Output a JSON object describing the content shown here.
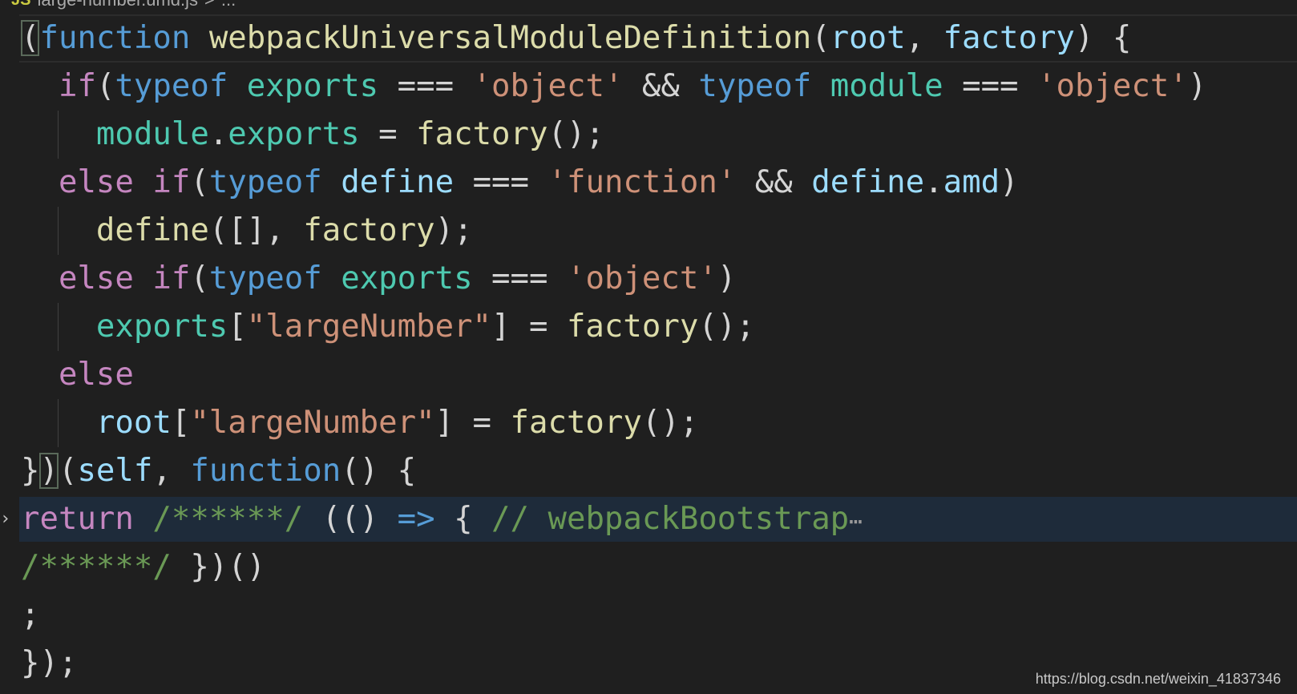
{
  "breadcrumb": {
    "icon": "JS",
    "file": "large-number.umd.js",
    "sep": ">",
    "more": "..."
  },
  "colors": {
    "keyword": "#c586c0",
    "storage": "#569cd6",
    "func": "#dcdcaa",
    "var": "#9cdcfe",
    "module": "#4ec9b0",
    "string": "#ce9178",
    "comment": "#6a9955",
    "punct": "#d4d4d4"
  },
  "lines": [
    {
      "tokens": [
        {
          "t": "(",
          "c": "punct",
          "box": true
        },
        {
          "t": "function",
          "c": "storage"
        },
        {
          "t": " "
        },
        {
          "t": "webpackUniversalModuleDefinition",
          "c": "func"
        },
        {
          "t": "("
        },
        {
          "t": "root",
          "c": "var"
        },
        {
          "t": ", "
        },
        {
          "t": "factory",
          "c": "var"
        },
        {
          "t": ") {"
        }
      ],
      "cursor": true
    },
    {
      "indent": "  ",
      "tokens": [
        {
          "t": "if",
          "c": "keyword"
        },
        {
          "t": "("
        },
        {
          "t": "typeof",
          "c": "storage"
        },
        {
          "t": " "
        },
        {
          "t": "exports",
          "c": "module"
        },
        {
          "t": " === "
        },
        {
          "t": "'object'",
          "c": "string"
        },
        {
          "t": " && "
        },
        {
          "t": "typeof",
          "c": "storage"
        },
        {
          "t": " "
        },
        {
          "t": "module",
          "c": "module"
        },
        {
          "t": " === "
        },
        {
          "t": "'object'",
          "c": "string"
        },
        {
          "t": ")"
        }
      ]
    },
    {
      "indent": "    ",
      "guide": true,
      "tokens": [
        {
          "t": "module",
          "c": "module"
        },
        {
          "t": "."
        },
        {
          "t": "exports",
          "c": "module"
        },
        {
          "t": " = "
        },
        {
          "t": "factory",
          "c": "func"
        },
        {
          "t": "();"
        }
      ]
    },
    {
      "indent": "  ",
      "tokens": [
        {
          "t": "else",
          "c": "keyword"
        },
        {
          "t": " "
        },
        {
          "t": "if",
          "c": "keyword"
        },
        {
          "t": "("
        },
        {
          "t": "typeof",
          "c": "storage"
        },
        {
          "t": " "
        },
        {
          "t": "define",
          "c": "var"
        },
        {
          "t": " === "
        },
        {
          "t": "'function'",
          "c": "string"
        },
        {
          "t": " && "
        },
        {
          "t": "define",
          "c": "var"
        },
        {
          "t": "."
        },
        {
          "t": "amd",
          "c": "var"
        },
        {
          "t": ")"
        }
      ]
    },
    {
      "indent": "    ",
      "guide": true,
      "tokens": [
        {
          "t": "define",
          "c": "func"
        },
        {
          "t": "([], "
        },
        {
          "t": "factory",
          "c": "func"
        },
        {
          "t": ");"
        }
      ]
    },
    {
      "indent": "  ",
      "tokens": [
        {
          "t": "else",
          "c": "keyword"
        },
        {
          "t": " "
        },
        {
          "t": "if",
          "c": "keyword"
        },
        {
          "t": "("
        },
        {
          "t": "typeof",
          "c": "storage"
        },
        {
          "t": " "
        },
        {
          "t": "exports",
          "c": "module"
        },
        {
          "t": " === "
        },
        {
          "t": "'object'",
          "c": "string"
        },
        {
          "t": ")"
        }
      ]
    },
    {
      "indent": "    ",
      "guide": true,
      "tokens": [
        {
          "t": "exports",
          "c": "module"
        },
        {
          "t": "["
        },
        {
          "t": "\"largeNumber\"",
          "c": "string"
        },
        {
          "t": "] = "
        },
        {
          "t": "factory",
          "c": "func"
        },
        {
          "t": "();"
        }
      ]
    },
    {
      "indent": "  ",
      "tokens": [
        {
          "t": "else",
          "c": "keyword"
        }
      ]
    },
    {
      "indent": "    ",
      "guide": true,
      "tokens": [
        {
          "t": "root",
          "c": "var"
        },
        {
          "t": "["
        },
        {
          "t": "\"largeNumber\"",
          "c": "string"
        },
        {
          "t": "] = "
        },
        {
          "t": "factory",
          "c": "func"
        },
        {
          "t": "();"
        }
      ]
    },
    {
      "tokens": [
        {
          "t": "}"
        },
        {
          "t": ")",
          "box": true
        },
        {
          "t": "("
        },
        {
          "t": "self",
          "c": "var"
        },
        {
          "t": ", "
        },
        {
          "t": "function",
          "c": "storage"
        },
        {
          "t": "() {"
        }
      ]
    },
    {
      "folded": true,
      "tokens": [
        {
          "t": "return",
          "c": "keyword"
        },
        {
          "t": " "
        },
        {
          "t": "/******/",
          "c": "comment"
        },
        {
          "t": " (() "
        },
        {
          "t": "=>",
          "c": "storage"
        },
        {
          "t": " { "
        },
        {
          "t": "// webpackBootstrap",
          "c": "comment"
        }
      ],
      "ellipsis": "⋯"
    },
    {
      "tokens": [
        {
          "t": "/******/",
          "c": "comment"
        },
        {
          "t": " })()"
        }
      ]
    },
    {
      "tokens": [
        {
          "t": ";"
        }
      ]
    },
    {
      "tokens": [
        {
          "t": "});"
        }
      ]
    }
  ],
  "watermark": "https://blog.csdn.net/weixin_41837346"
}
